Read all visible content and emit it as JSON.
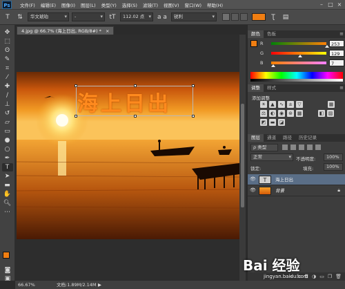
{
  "app": {
    "logo": "Ps"
  },
  "menubar": {
    "items": [
      "文件(F)",
      "编辑(E)",
      "图像(I)",
      "图层(L)",
      "类型(Y)",
      "选择(S)",
      "滤镜(T)",
      "视图(V)",
      "窗口(W)",
      "帮助(H)"
    ]
  },
  "options": {
    "font_family": "华文琥珀",
    "font_style": "-",
    "size_icon": "tT",
    "font_size": "112.02 点",
    "aa_icon": "a a",
    "anti_alias": "锐利",
    "color": "#f07e12"
  },
  "document": {
    "tab_title": "4.jpg @ 66.7% (海上日出, RGB/8#) *",
    "overlay_text": "海上日出"
  },
  "status": {
    "zoom": "66.67%",
    "doc": "文档:1.89M/2.14M",
    "arrow": "▶"
  },
  "color_panel": {
    "tabs": [
      "颜色",
      "色板"
    ],
    "r": 253,
    "g": 129,
    "b": 7,
    "labels": [
      "R",
      "G",
      "B"
    ]
  },
  "adjust_panel": {
    "tabs": [
      "调整",
      "样式"
    ],
    "title": "添加调整"
  },
  "layers_panel": {
    "tabs": [
      "图层",
      "通道",
      "路径",
      "历史记录"
    ],
    "filter": "ρ 类型",
    "blend": "正常",
    "opacity_label": "不透明度:",
    "opacity": "100%",
    "lock_label": "锁定:",
    "fill_label": "填充:",
    "fill": "100%",
    "layers": [
      {
        "name": "海上日出",
        "kind": "text",
        "selected": true
      },
      {
        "name": "背景",
        "kind": "image",
        "selected": false
      }
    ]
  },
  "watermark": {
    "brand": "Bai 经验",
    "url": "jingyan.baidu.com"
  },
  "icons": [
    "move-icon",
    "marquee-icon",
    "lasso-icon",
    "quick-select-icon",
    "crop-icon",
    "eyedropper-icon",
    "healing-icon",
    "brush-icon",
    "stamp-icon",
    "history-brush-icon",
    "eraser-icon",
    "gradient-icon",
    "blur-icon",
    "dodge-icon",
    "pen-icon",
    "type-icon",
    "path-select-icon",
    "shape-icon",
    "hand-icon",
    "zoom-icon"
  ]
}
